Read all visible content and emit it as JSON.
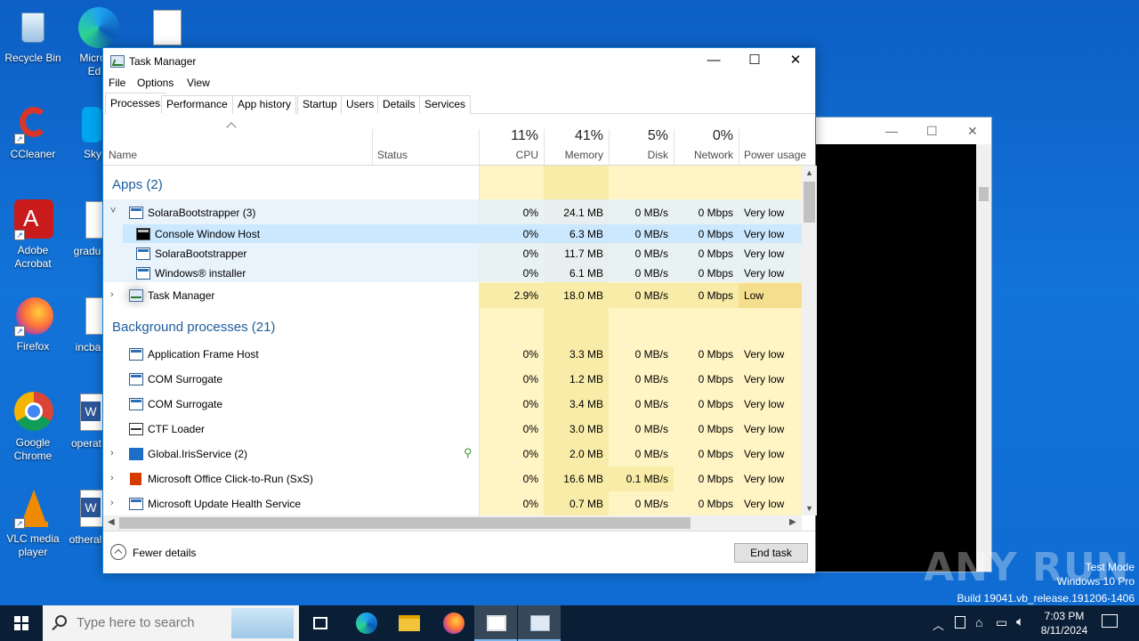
{
  "desktop": {
    "icons": [
      {
        "label": "Recycle Bin"
      },
      {
        "label": "CCleaner"
      },
      {
        "label": "Adobe Acrobat"
      },
      {
        "label": "Firefox"
      },
      {
        "label": "Google Chrome"
      },
      {
        "label": "VLC media player"
      }
    ],
    "partial_labels": [
      "Micro",
      "Ed",
      "Sky",
      "gradu",
      "incba",
      "operat",
      "otheral"
    ]
  },
  "window": {
    "title": "Task Manager",
    "controls": {
      "minimize": "—",
      "maximize": "☐",
      "close": "✕"
    }
  },
  "menu": [
    "File",
    "Options",
    "View"
  ],
  "tabs": [
    "Processes",
    "Performance",
    "App history",
    "Startup",
    "Users",
    "Details",
    "Services"
  ],
  "active_tab": "Processes",
  "columns": {
    "name": "Name",
    "status": "Status",
    "cpu": {
      "pct": "11%",
      "label": "CPU"
    },
    "memory": {
      "pct": "41%",
      "label": "Memory"
    },
    "disk": {
      "pct": "5%",
      "label": "Disk"
    },
    "network": {
      "pct": "0%",
      "label": "Network"
    },
    "power": "Power usage"
  },
  "groups": {
    "apps": "Apps (2)",
    "background": "Background processes (21)"
  },
  "rows": [
    {
      "name": "SolaraBootstrapper (3)",
      "cpu": "0%",
      "mem": "24.1 MB",
      "disk": "0 MB/s",
      "net": "0 Mbps",
      "power": "Very low"
    },
    {
      "name": "Console Window Host",
      "cpu": "0%",
      "mem": "6.3 MB",
      "disk": "0 MB/s",
      "net": "0 Mbps",
      "power": "Very low"
    },
    {
      "name": "SolaraBootstrapper",
      "cpu": "0%",
      "mem": "11.7 MB",
      "disk": "0 MB/s",
      "net": "0 Mbps",
      "power": "Very low"
    },
    {
      "name": "Windows® installer",
      "cpu": "0%",
      "mem": "6.1 MB",
      "disk": "0 MB/s",
      "net": "0 Mbps",
      "power": "Very low"
    },
    {
      "name": "Task Manager",
      "cpu": "2.9%",
      "mem": "18.0 MB",
      "disk": "0 MB/s",
      "net": "0 Mbps",
      "power": "Low"
    },
    {
      "name": "Application Frame Host",
      "cpu": "0%",
      "mem": "3.3 MB",
      "disk": "0 MB/s",
      "net": "0 Mbps",
      "power": "Very low"
    },
    {
      "name": "COM Surrogate",
      "cpu": "0%",
      "mem": "1.2 MB",
      "disk": "0 MB/s",
      "net": "0 Mbps",
      "power": "Very low"
    },
    {
      "name": "COM Surrogate",
      "cpu": "0%",
      "mem": "3.4 MB",
      "disk": "0 MB/s",
      "net": "0 Mbps",
      "power": "Very low"
    },
    {
      "name": "CTF Loader",
      "cpu": "0%",
      "mem": "3.0 MB",
      "disk": "0 MB/s",
      "net": "0 Mbps",
      "power": "Very low"
    },
    {
      "name": "Global.IrisService (2)",
      "cpu": "0%",
      "mem": "2.0 MB",
      "disk": "0 MB/s",
      "net": "0 Mbps",
      "power": "Very low"
    },
    {
      "name": "Microsoft Office Click-to-Run (SxS)",
      "cpu": "0%",
      "mem": "16.6 MB",
      "disk": "0.1 MB/s",
      "net": "0 Mbps",
      "power": "Very low"
    },
    {
      "name": "Microsoft Update Health Service",
      "cpu": "0%",
      "mem": "0.7 MB",
      "disk": "0 MB/s",
      "net": "0 Mbps",
      "power": "Very low"
    }
  ],
  "footer": {
    "fewer_details": "Fewer details",
    "end_task": "End task"
  },
  "watermark": "ANY RUN",
  "os_info": {
    "line1": "Test Mode",
    "line2": "Windows 10 Pro",
    "line3": "Build 19041.vb_release.191206-1406"
  },
  "taskbar": {
    "search_placeholder": "Type here to search",
    "time": "7:03 PM",
    "date": "8/11/2024"
  },
  "colors": {
    "accent": "#1883d7",
    "group_text": "#1c5c9c",
    "heat_light": "#fff4c4",
    "heat_medium": "#f9eca8",
    "selected_row": "#cce8ff",
    "apps_row": "#e5f1fb"
  }
}
